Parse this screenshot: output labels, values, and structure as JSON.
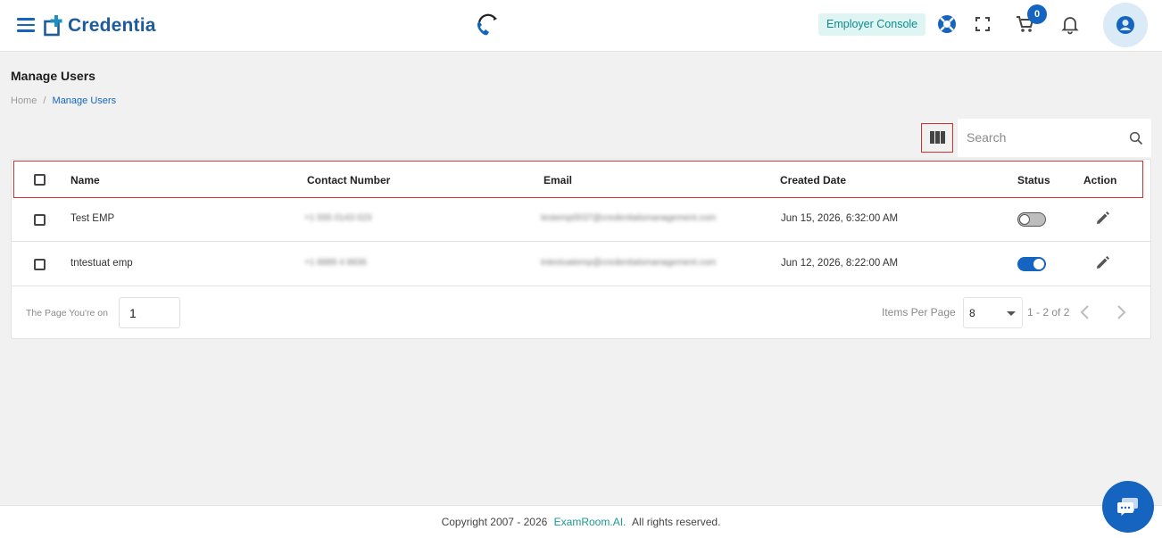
{
  "header": {
    "brand": "Credentia",
    "console_label": "Employer Console",
    "cart_count": "0"
  },
  "page": {
    "title": "Manage Users",
    "breadcrumb_home": "Home",
    "breadcrumb_sep": "/",
    "breadcrumb_current": "Manage Users"
  },
  "search": {
    "placeholder": "Search"
  },
  "table": {
    "columns": [
      "Name",
      "Contact Number",
      "Email",
      "Created Date",
      "Status",
      "Action"
    ],
    "rows": [
      {
        "name": "Test EMP",
        "contact": "+1 555 0143 023",
        "email": "testemp0037@credentialsmanagement.com",
        "created": "Jun 15, 2026, 6:32:00 AM",
        "status": "off"
      },
      {
        "name": "tntestuat emp",
        "contact": "+1 8889 4 8836",
        "email": "tntestuatemp@credentialsmanagement.com",
        "created": "Jun 12, 2026, 8:22:00 AM",
        "status": "on"
      }
    ]
  },
  "pagination": {
    "page_label": "The Page You're on",
    "page_value": "1",
    "ipp_label": "Items Per Page",
    "ipp_value": "8",
    "range": "1 - 2 of 2"
  },
  "footer": {
    "copyright": "Copyright 2007 - 2026",
    "brand": "ExamRoom.AI.",
    "rights": "All rights reserved."
  },
  "colors": {
    "primary": "#1565c0",
    "teal": "#1a9a8e",
    "highlight": "#d32f2f"
  }
}
